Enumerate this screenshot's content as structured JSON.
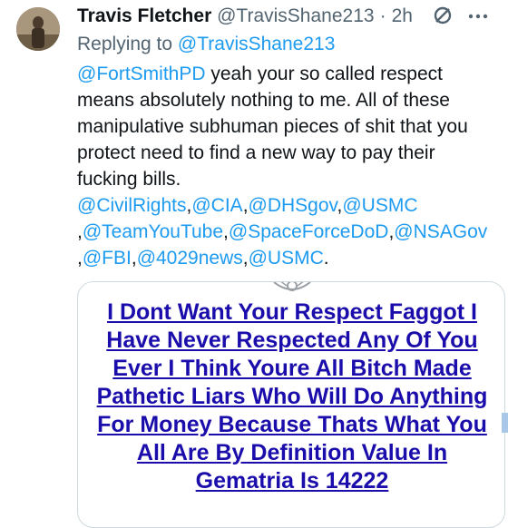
{
  "tweet": {
    "author_name": "Travis Fletcher",
    "author_handle": "@TravisShane213",
    "separator": "·",
    "time": "2h",
    "replying_label": "Replying to",
    "replying_to": "@TravisShane213",
    "body_mention": "@FortSmithPD",
    "body_text": " yeah your so called respect means absolutely nothing to me. All of these manipulative subhuman pieces of shit that you protect need to find a new way to pay their fucking bills.",
    "tags": [
      "@CivilRights",
      ",",
      "@CIA",
      ",",
      "@DHSgov",
      ",",
      "@USMC",
      " ,",
      "@TeamYouTube",
      ",",
      "@SpaceForceDoD",
      ",",
      "@NSAGov",
      " ,",
      "@FBI",
      ",",
      "@4029news",
      ",",
      "@USMC",
      "."
    ],
    "card_text": "I Dont Want Your Respect Faggot I Have Never Respected Any Of You Ever I Think Youre All Bitch Made Pathetic Liars Who Will Do Anything For Money Because Thats What You All Are By Definition Value In Gematria Is 14222"
  },
  "icons": {
    "verify": "circle-slash-icon",
    "more": "more-icon"
  },
  "colors": {
    "link": "#1d9bf0",
    "card_link": "#1a0dab",
    "secondary": "#536471",
    "text": "#0f1419"
  }
}
